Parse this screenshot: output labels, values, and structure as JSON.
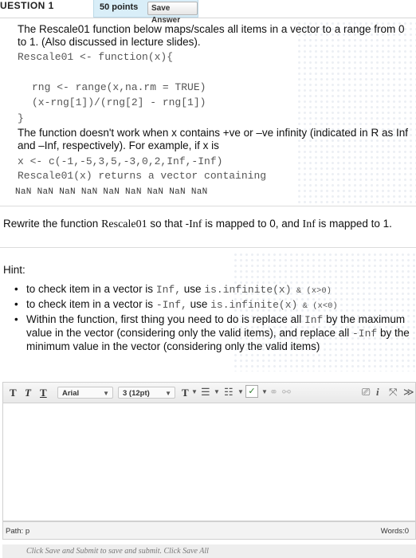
{
  "header": {
    "question_label": "UESTION 1",
    "points": "50 points",
    "save_label": "Save Answer"
  },
  "prompt": {
    "intro": "The Rescale01 function below maps/scales all items in a vector to a range from 0 to 1. (Also discussed in lecture slides).",
    "code_line1": "Rescale01 <- function(x){",
    "code_line2": "rng <- range(x,na.rm = TRUE)",
    "code_line3": "(x-rng[1])/(rng[2] - rng[1])",
    "code_line4": "}",
    "problem": "The function doesn't work when x contains +ve or –ve infinity (indicated in R as Inf and –Inf, respectively). For example, if x is",
    "example_line": "x <- c(-1,-5,3,5,-3,0,2,Inf,-Inf)",
    "returns_line": "Rescale01(x) returns a vector containing",
    "nan_line": "NaN NaN NaN NaN NaN NaN NaN NaN NaN"
  },
  "rewrite": {
    "part1": "Rewrite the function ",
    "fname": "Rescale01",
    "part2": " so that -",
    "inf1": "Inf",
    "part3": " is mapped to 0, and ",
    "inf2": "Inf",
    "part4": " is mapped to 1."
  },
  "hint": {
    "title": "Hint:",
    "b1_text": "to check item in a vector is ",
    "b1_code": "Inf,",
    "b1_use": " use ",
    "b1_expr": "is.infinite(x)",
    "b1_and": " & (x>0)",
    "b2_text": "to check item in a vector is ",
    "b2_code": "-Inf,",
    "b2_use": " use ",
    "b2_expr": "is.infinite(x)",
    "b2_and": " & (x<0)",
    "b3_p1": "Within the function, first thing you need to do is replace all ",
    "b3_code1": "Inf",
    "b3_p2": " by the maximum value in the vector (considering only the valid items), and replace all ",
    "b3_code2": "-Inf",
    "b3_p3": " by the minimum value in the vector (considering only the valid items)"
  },
  "toolbar": {
    "t1": "T",
    "t2": "T",
    "t3": "T",
    "font": "Arial",
    "size": "3 (12pt)",
    "t4": "T"
  },
  "status": {
    "path": "Path: p",
    "words": "Words:0"
  },
  "footer": {
    "note": "Click Save and Submit to save and submit. Click Save All"
  }
}
